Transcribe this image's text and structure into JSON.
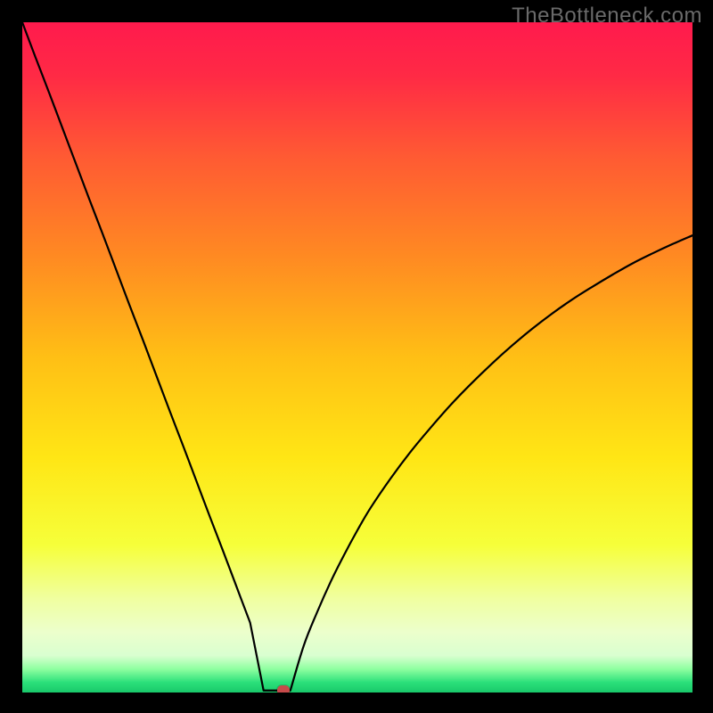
{
  "watermark": "TheBottleneck.com",
  "colors": {
    "page_bg": "#000000",
    "curve_stroke": "#000000",
    "marker": "#c74a4a",
    "gradient_stops": [
      {
        "offset": 0.0,
        "color": "#ff1a4d"
      },
      {
        "offset": 0.08,
        "color": "#ff2a45"
      },
      {
        "offset": 0.2,
        "color": "#ff5a33"
      },
      {
        "offset": 0.35,
        "color": "#ff8a22"
      },
      {
        "offset": 0.5,
        "color": "#ffbf15"
      },
      {
        "offset": 0.65,
        "color": "#ffe615"
      },
      {
        "offset": 0.78,
        "color": "#f6ff3a"
      },
      {
        "offset": 0.86,
        "color": "#f0ffa0"
      },
      {
        "offset": 0.91,
        "color": "#ecffcc"
      },
      {
        "offset": 0.945,
        "color": "#d9ffd0"
      },
      {
        "offset": 0.965,
        "color": "#8effa0"
      },
      {
        "offset": 0.985,
        "color": "#2be07a"
      },
      {
        "offset": 1.0,
        "color": "#19c86a"
      }
    ]
  },
  "chart_data": {
    "type": "line",
    "title": "",
    "xlabel": "",
    "ylabel": "",
    "x_range": [
      0,
      100
    ],
    "y_range": [
      0,
      100
    ],
    "minimum_x": 38,
    "flat_bottom": {
      "x_start": 36.0,
      "x_end": 40.0,
      "y": 0.3
    },
    "series": [
      {
        "name": "bottleneck_curve",
        "x": [
          0,
          2,
          4,
          6,
          8,
          10,
          12,
          14,
          16,
          18,
          20,
          22,
          24,
          26,
          28,
          30,
          32,
          34,
          36,
          38,
          40,
          42,
          44,
          46,
          48,
          50,
          52,
          55,
          58,
          61,
          64,
          67,
          70,
          73,
          76,
          79,
          82,
          85,
          88,
          91,
          94,
          97,
          100
        ],
        "y": [
          100,
          94.7,
          89.5,
          84.2,
          78.9,
          73.6,
          68.4,
          63.1,
          57.8,
          52.6,
          47.3,
          42.0,
          36.8,
          31.5,
          26.2,
          21.0,
          15.7,
          10.4,
          0.3,
          0.3,
          0.3,
          7.0,
          12.0,
          16.5,
          20.5,
          24.2,
          27.6,
          32.0,
          36.0,
          39.6,
          43.0,
          46.1,
          49.0,
          51.7,
          54.2,
          56.5,
          58.6,
          60.5,
          62.3,
          64.0,
          65.5,
          66.9,
          68.2
        ]
      }
    ],
    "marker": {
      "x": 39,
      "y": 0.3
    }
  }
}
